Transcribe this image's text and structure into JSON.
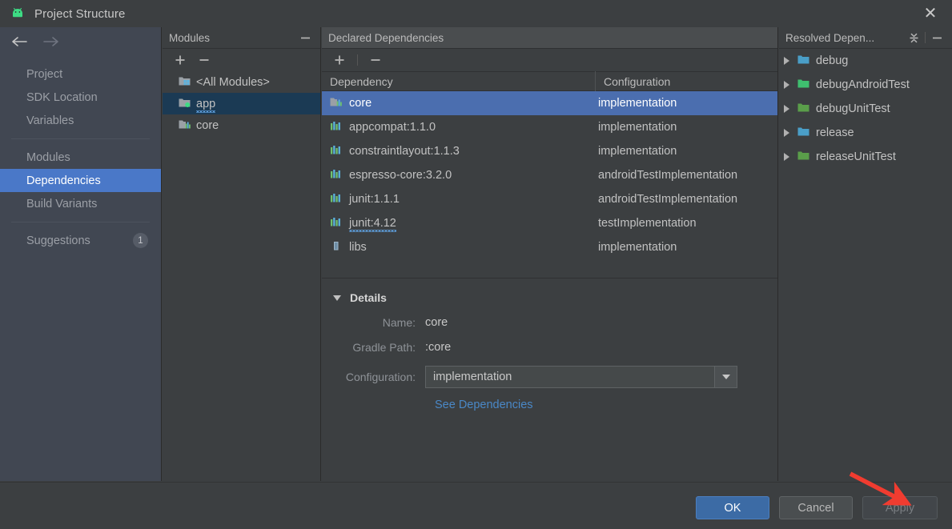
{
  "window": {
    "title": "Project Structure",
    "app_icon": "android-icon",
    "close_label": "✕"
  },
  "nav": {
    "back_icon": "arrow-left-icon",
    "forward_icon": "arrow-right-icon"
  },
  "sidebar": {
    "items": [
      {
        "label": "Project",
        "selected": false,
        "badge": null
      },
      {
        "label": "SDK Location",
        "selected": false,
        "badge": null
      },
      {
        "label": "Variables",
        "selected": false,
        "badge": null
      },
      {
        "label": "Modules",
        "selected": false,
        "badge": null
      },
      {
        "label": "Dependencies",
        "selected": true,
        "badge": null
      },
      {
        "label": "Build Variants",
        "selected": false,
        "badge": null
      },
      {
        "label": "Suggestions",
        "selected": false,
        "badge": "1"
      }
    ],
    "selected_color": "#4a78c8"
  },
  "modules_panel": {
    "header": "Modules",
    "collapse_icon": "minimize-icon",
    "add_icon": "plus-icon",
    "remove_icon": "minus-icon",
    "rows": [
      {
        "label": "<All Modules>",
        "icon": "all-modules-icon",
        "selected": false,
        "warning": false
      },
      {
        "label": "app",
        "icon": "android-module-icon",
        "selected": true,
        "warning": true
      },
      {
        "label": "core",
        "icon": "library-module-icon",
        "selected": false,
        "warning": false
      }
    ]
  },
  "declared_panel": {
    "header": "Declared Dependencies",
    "add_icon": "plus-icon",
    "remove_icon": "minus-icon",
    "columns": [
      "Dependency",
      "Configuration"
    ],
    "rows": [
      {
        "name": "core",
        "configuration": "implementation",
        "icon": "library-module-icon",
        "selected": true,
        "warning": false
      },
      {
        "name": "appcompat:1.1.0",
        "configuration": "implementation",
        "icon": "library-icon",
        "selected": false,
        "warning": false
      },
      {
        "name": "constraintlayout:1.1.3",
        "configuration": "implementation",
        "icon": "library-icon",
        "selected": false,
        "warning": false
      },
      {
        "name": "espresso-core:3.2.0",
        "configuration": "androidTestImplementation",
        "icon": "library-icon",
        "selected": false,
        "warning": false
      },
      {
        "name": "junit:1.1.1",
        "configuration": "androidTestImplementation",
        "icon": "library-icon",
        "selected": false,
        "warning": false
      },
      {
        "name": "junit:4.12",
        "configuration": "testImplementation",
        "icon": "library-icon",
        "selected": false,
        "warning": true
      },
      {
        "name": "libs",
        "configuration": "implementation",
        "icon": "jar-icon",
        "selected": false,
        "warning": false
      }
    ],
    "selected_color": "#4b6eaf"
  },
  "details": {
    "title": "Details",
    "expand_icon": "triangle-down-icon",
    "name_label": "Name:",
    "name_value": "core",
    "gradle_path_label": "Gradle Path:",
    "gradle_path_value": ":core",
    "configuration_label": "Configuration:",
    "configuration_value": "implementation",
    "dropdown_icon": "chevron-down-icon",
    "see_dependencies_link": "See Dependencies",
    "link_color": "#4a88c7"
  },
  "resolved_panel": {
    "header": "Resolved Depen...",
    "collapse_all_icon": "collapse-all-icon",
    "minimize_icon": "minimize-icon",
    "rows": [
      {
        "label": "debug",
        "icon": "folder-blue-icon",
        "expanded": false
      },
      {
        "label": "debugAndroidTest",
        "icon": "folder-green-icon",
        "expanded": false
      },
      {
        "label": "debugUnitTest",
        "icon": "folder-green-icon",
        "expanded": false
      },
      {
        "label": "release",
        "icon": "folder-blue-icon",
        "expanded": false
      },
      {
        "label": "releaseUnitTest",
        "icon": "folder-green-icon",
        "expanded": false
      }
    ]
  },
  "buttons": {
    "ok": "OK",
    "cancel": "Cancel",
    "apply": "Apply",
    "ok_color": "#3c6ba5"
  },
  "annotation": {
    "arrow_color": "#f03c30",
    "points_to": "Apply"
  }
}
